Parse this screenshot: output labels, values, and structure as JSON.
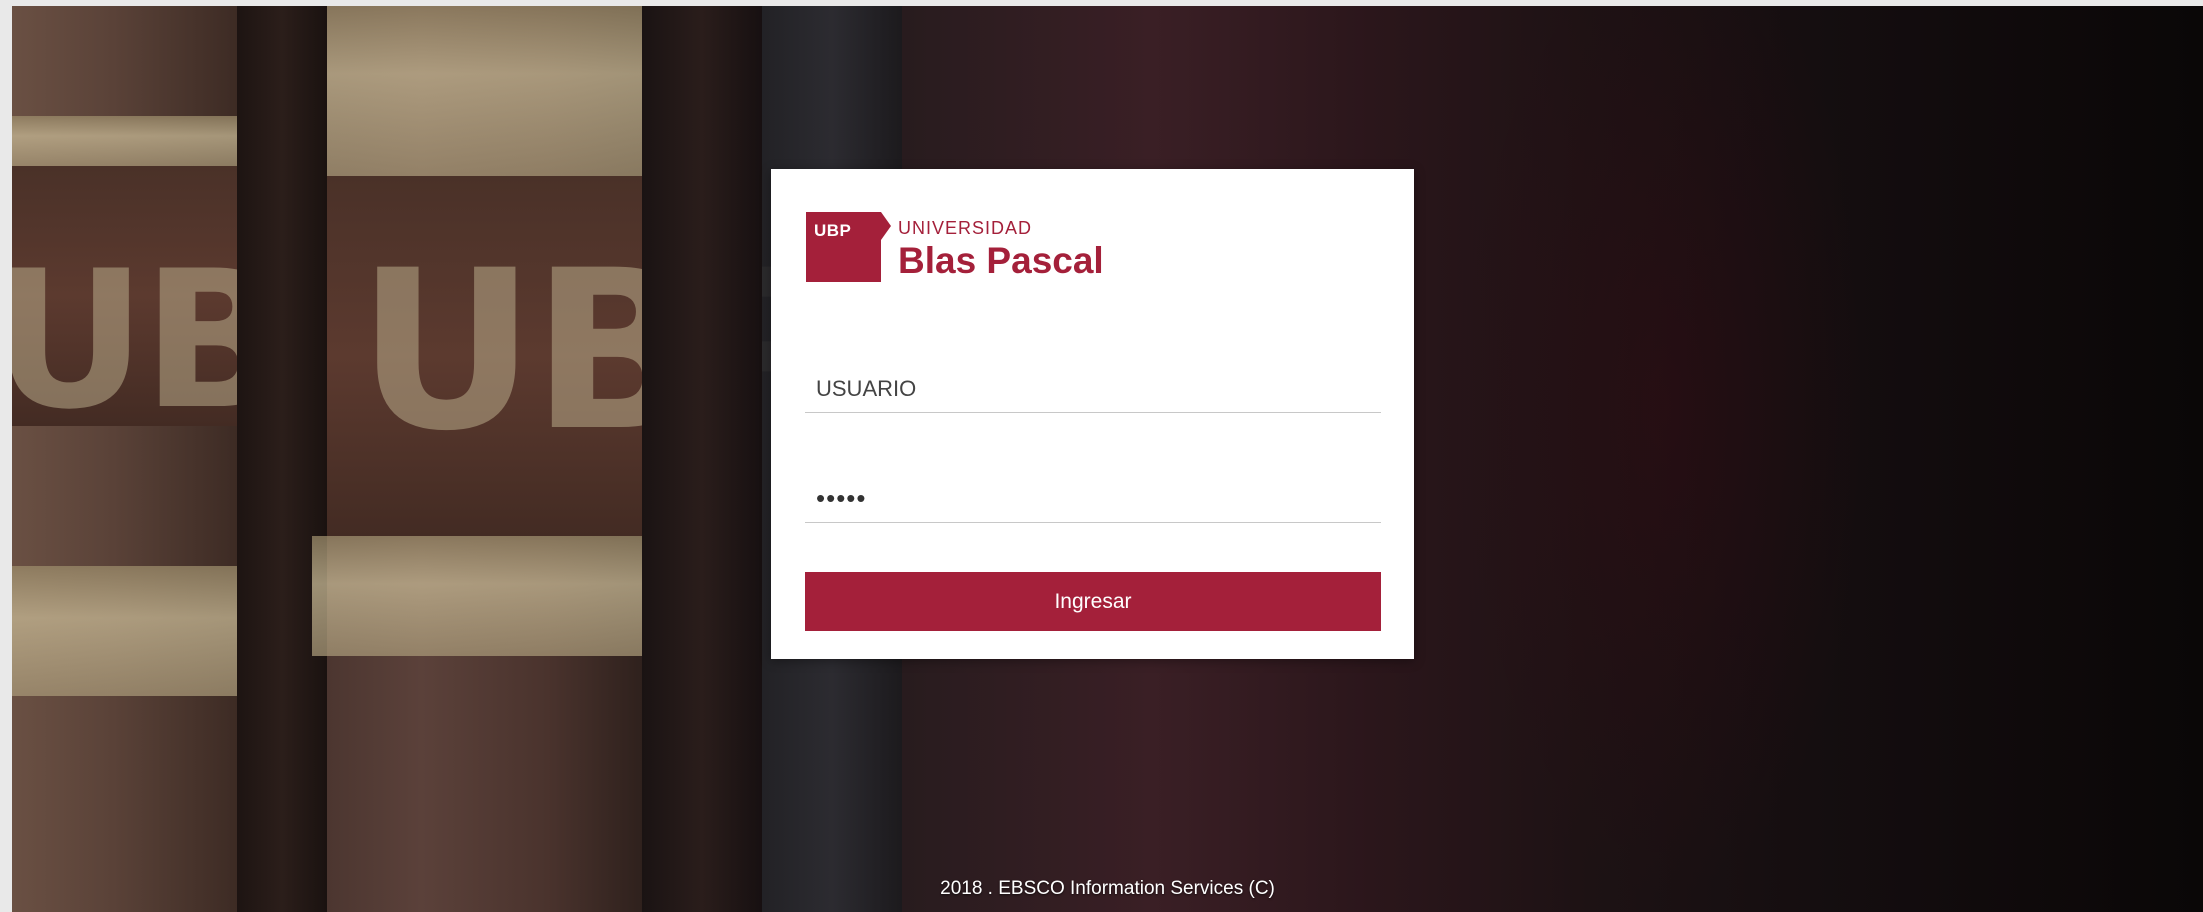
{
  "background": {
    "spine_label_1": "UBP",
    "spine_label_2": "UBP"
  },
  "login": {
    "logo": {
      "abbr": "UBP",
      "top_line": "UNIVERSIDAD",
      "main_line": "Blas Pascal"
    },
    "username": {
      "placeholder": "USUARIO",
      "value": ""
    },
    "password": {
      "value": "•••••"
    },
    "submit_label": "Ingresar"
  },
  "footer": {
    "text": "2018 . EBSCO Information Services (C)"
  },
  "colors": {
    "brand": "#a4203a",
    "card": "#ffffff",
    "field_border": "#c8c8c8"
  }
}
